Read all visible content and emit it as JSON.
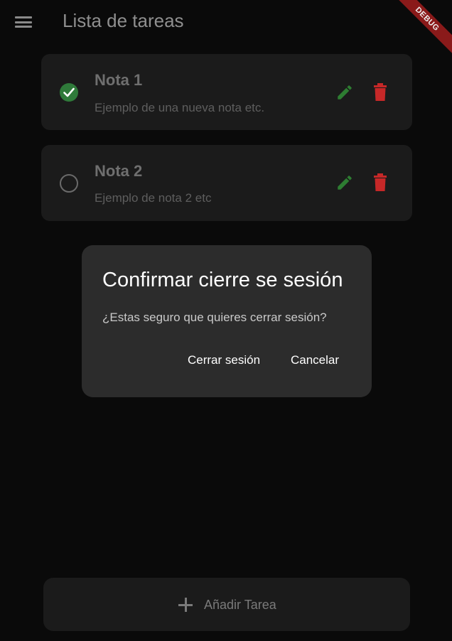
{
  "appbar": {
    "title": "Lista de tareas",
    "menu_icon": "hamburger-menu-icon",
    "debug_banner": "DEBUG"
  },
  "tasks": [
    {
      "title": "Nota 1",
      "description": "Ejemplo de una nueva nota etc.",
      "completed": true
    },
    {
      "title": "Nota 2",
      "description": "Ejemplo de nota 2 etc",
      "completed": false
    }
  ],
  "dialog": {
    "title": "Confirmar cierre se sesión",
    "message": "¿Estas seguro que quieres cerrar sesión?",
    "confirm_label": "Cerrar sesión",
    "cancel_label": "Cancelar"
  },
  "add_button": {
    "label": "Añadir Tarea",
    "icon": "plus-icon"
  },
  "colors": {
    "background": "#0a0a0a",
    "card": "#1b1b1b",
    "dialog": "#2c2c2c",
    "check_done": "#2f7a3a",
    "edit_icon": "#2e7d32",
    "delete_icon": "#c62828",
    "debug_banner": "#8a1a1a"
  }
}
